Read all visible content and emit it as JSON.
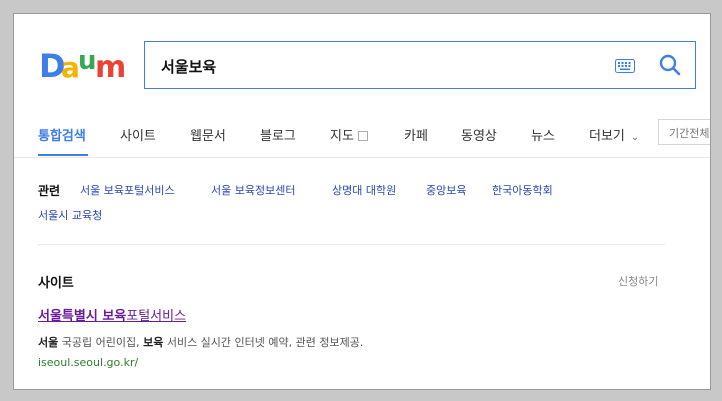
{
  "search": {
    "query": "서울보육"
  },
  "tabs": [
    {
      "label": "통합검색",
      "active": true
    },
    {
      "label": "사이트"
    },
    {
      "label": "웹문서"
    },
    {
      "label": "블로그"
    },
    {
      "label": "지도"
    },
    {
      "label": "카페"
    },
    {
      "label": "동영상"
    },
    {
      "label": "뉴스"
    },
    {
      "label": "더보기"
    }
  ],
  "period_filter": "기간전체",
  "related": {
    "label": "관련",
    "items": [
      "서울 보육포털서비스",
      "서울 보육정보센터",
      "상명대 대학원",
      "중앙보육",
      "한국아동학회",
      "서울시 교육청"
    ]
  },
  "site_section": {
    "title": "사이트",
    "register": "신청하기",
    "result": {
      "title_bold": "서울특별시 보육",
      "title_rest": "포털서비스",
      "desc_bold1": "서울",
      "desc_mid": " 국공립 어린이집, ",
      "desc_bold2": "보육",
      "desc_rest": " 서비스 실시간 인터넷 예약, 관련 정보제공.",
      "url": "iseoul.seoul.go.kr/"
    }
  },
  "colors": {
    "accent": "#3e7ee8",
    "related_link": "#2a47b4",
    "visited_title": "#6a1b9a",
    "url_green": "#2e7d32",
    "logo_blue": "#3e7ee8",
    "logo_yellow": "#f4b400",
    "logo_red": "#ea4335",
    "logo_green": "#34a853"
  },
  "icons": [
    "daum-logo",
    "keyboard-icon",
    "search-icon",
    "map-square-icon",
    "chevron-down-icon"
  ]
}
